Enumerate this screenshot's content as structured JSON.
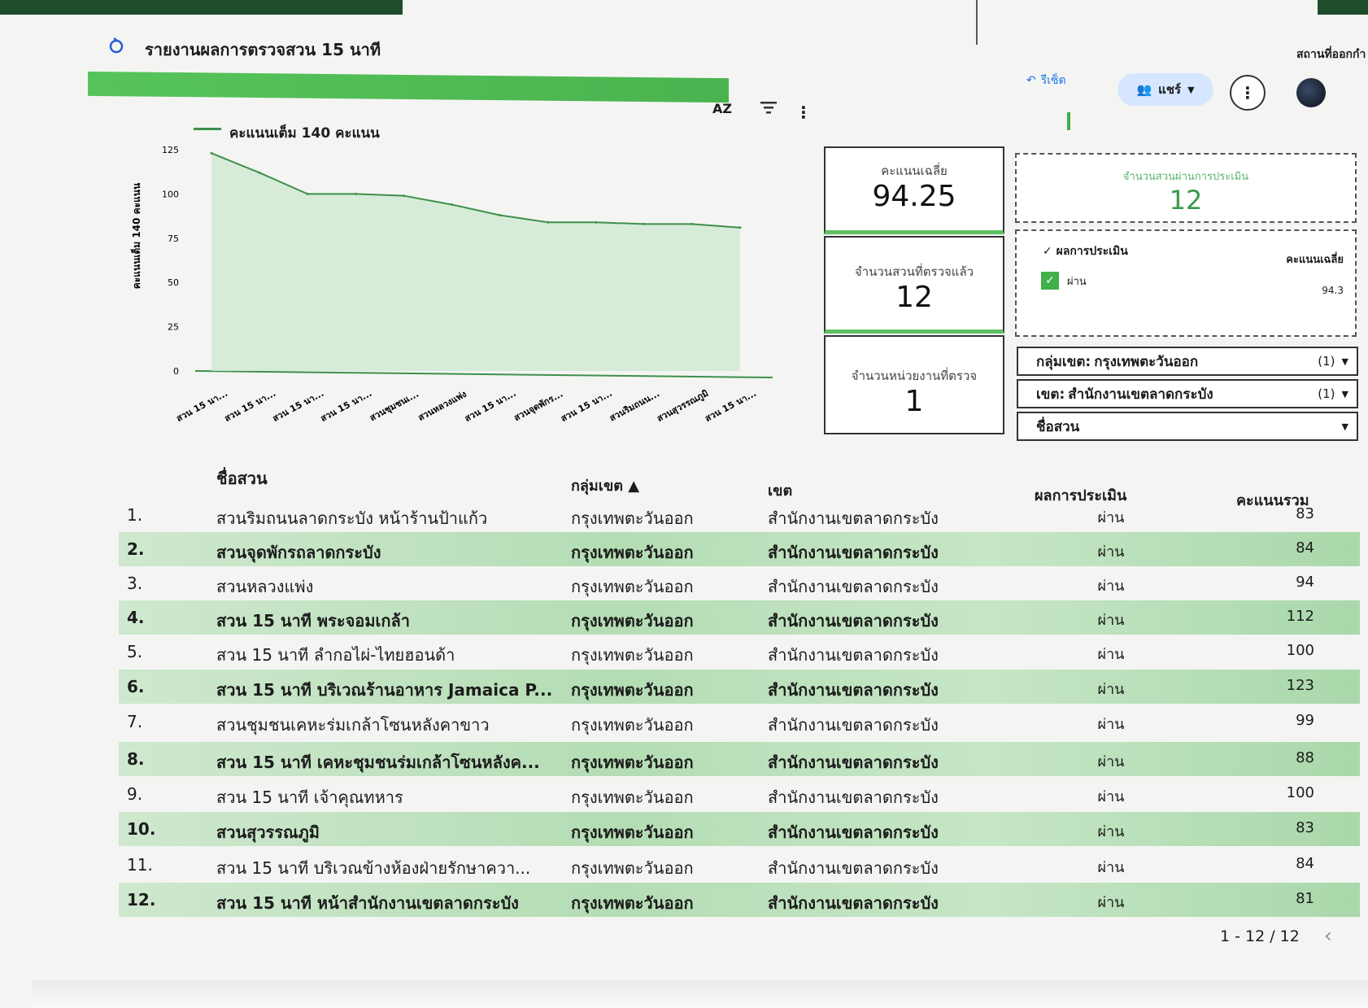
{
  "app": {
    "title": "รายงานผลการตรวจสวน 15 นาที",
    "status_label": "สถานที่ออกกำ"
  },
  "toolbar": {
    "sort_label": "AZ",
    "reset_label": "รีเซ็ต",
    "share_label": "แชร์",
    "more_label": "⋮"
  },
  "chart_data": {
    "type": "area",
    "legend": "คะแนนเต็ม 140 คะแนน",
    "ylabel": "คะแนนเต็ม 140 คะแนน",
    "ylim": [
      0,
      125
    ],
    "yticks": [
      125,
      100,
      75,
      50,
      25,
      0
    ],
    "categories": [
      "สวน 15 นา...",
      "สวน 15 นา...",
      "สวน 15 นา...",
      "สวน 15 นา...",
      "สวนชุมชนเ...",
      "สวนหลวงแพ่ง",
      "สวน 15 นา...",
      "สวนจุดพักร...",
      "สวน 15 นา...",
      "สวนริมถนน...",
      "สวนสุวรรณภูมิ",
      "สวน 15 นา..."
    ],
    "values": [
      123,
      112,
      100,
      100,
      99,
      94,
      88,
      84,
      84,
      83,
      83,
      81
    ],
    "series_color": "#3f8f4a",
    "fill_color": "#cfe9d2"
  },
  "scorecards": {
    "avg_label": "คะแนนเฉลี่ย",
    "avg_value": "94.25",
    "checked_label": "จำนวนสวนที่ตรวจแล้ว",
    "checked_value": "12",
    "units_label": "จำนวนหน่วยงานที่ตรวจ",
    "units_value": "1",
    "passed_label": "จำนวนสวนผ่านการประเมิน",
    "passed_value": "12"
  },
  "result_table": {
    "header_result": "ผลการประเมิน",
    "header_avg": "คะแนนเฉลี่ย",
    "row_label": "ผ่าน",
    "row_value": "94.3"
  },
  "filters": [
    {
      "label": "กลุ่มเขต:",
      "value": "กรุงเทพตะวันออก",
      "count": "(1)"
    },
    {
      "label": "เขต:",
      "value": "สำนักงานเขตลาดกระบัง",
      "count": "(1)"
    },
    {
      "label": "ชื่อสวน",
      "value": "",
      "count": ""
    }
  ],
  "table": {
    "headers": {
      "name": "ชื่อสวน",
      "group": "กลุ่มเขต ▲",
      "district": "เขต",
      "result": "ผลการประเมิน",
      "score": "คะแนนรวม"
    },
    "rows": [
      {
        "num": "1.",
        "name": "สวนริมถนนลาดกระบัง หน้าร้านป้าแก้ว",
        "group": "กรุงเทพตะวันออก",
        "district": "สำนักงานเขตลาดกระบัง",
        "result": "ผ่าน",
        "score": "83"
      },
      {
        "num": "2.",
        "name": "สวนจุดพักรถลาดกระบัง",
        "group": "กรุงเทพตะวันออก",
        "district": "สำนักงานเขตลาดกระบัง",
        "result": "ผ่าน",
        "score": "84"
      },
      {
        "num": "3.",
        "name": "สวนหลวงแพ่ง",
        "group": "กรุงเทพตะวันออก",
        "district": "สำนักงานเขตลาดกระบัง",
        "result": "ผ่าน",
        "score": "94"
      },
      {
        "num": "4.",
        "name": "สวน 15 นาที พระจอมเกล้า",
        "group": "กรุงเทพตะวันออก",
        "district": "สำนักงานเขตลาดกระบัง",
        "result": "ผ่าน",
        "score": "112"
      },
      {
        "num": "5.",
        "name": "สวน 15 นาที ลำกอไผ่-ไทยฮอนด้า",
        "group": "กรุงเทพตะวันออก",
        "district": "สำนักงานเขตลาดกระบัง",
        "result": "ผ่าน",
        "score": "100"
      },
      {
        "num": "6.",
        "name": "สวน 15 นาที บริเวณร้านอาหาร Jamaica P...",
        "group": "กรุงเทพตะวันออก",
        "district": "สำนักงานเขตลาดกระบัง",
        "result": "ผ่าน",
        "score": "123"
      },
      {
        "num": "7.",
        "name": "สวนชุมชนเคหะร่มเกล้าโซนหลังคาขาว",
        "group": "กรุงเทพตะวันออก",
        "district": "สำนักงานเขตลาดกระบัง",
        "result": "ผ่าน",
        "score": "99"
      },
      {
        "num": "8.",
        "name": "สวน 15 นาที เคหะชุมชนร่มเกล้าโซนหลังค...",
        "group": "กรุงเทพตะวันออก",
        "district": "สำนักงานเขตลาดกระบัง",
        "result": "ผ่าน",
        "score": "88"
      },
      {
        "num": "9.",
        "name": "สวน 15 นาที เจ้าคุณทหาร",
        "group": "กรุงเทพตะวันออก",
        "district": "สำนักงานเขตลาดกระบัง",
        "result": "ผ่าน",
        "score": "100"
      },
      {
        "num": "10.",
        "name": "สวนสุวรรณภูมิ",
        "group": "กรุงเทพตะวันออก",
        "district": "สำนักงานเขตลาดกระบัง",
        "result": "ผ่าน",
        "score": "83"
      },
      {
        "num": "11.",
        "name": "สวน 15 นาที บริเวณข้างห้องฝ่ายรักษาควา...",
        "group": "กรุงเทพตะวันออก",
        "district": "สำนักงานเขตลาดกระบัง",
        "result": "ผ่าน",
        "score": "84"
      },
      {
        "num": "12.",
        "name": "สวน 15 นาที หน้าสำนักงานเขตลาดกระบัง",
        "group": "กรุงเทพตะวันออก",
        "district": "สำนักงานเขตลาดกระบัง",
        "result": "ผ่าน",
        "score": "81"
      }
    ]
  },
  "pagination": {
    "text": "1 - 12 / 12",
    "prev": "‹"
  },
  "colors": {
    "accent_green": "#4ab34f",
    "row_highlight": "#b4ddb4",
    "link_blue": "#1a73e8"
  }
}
